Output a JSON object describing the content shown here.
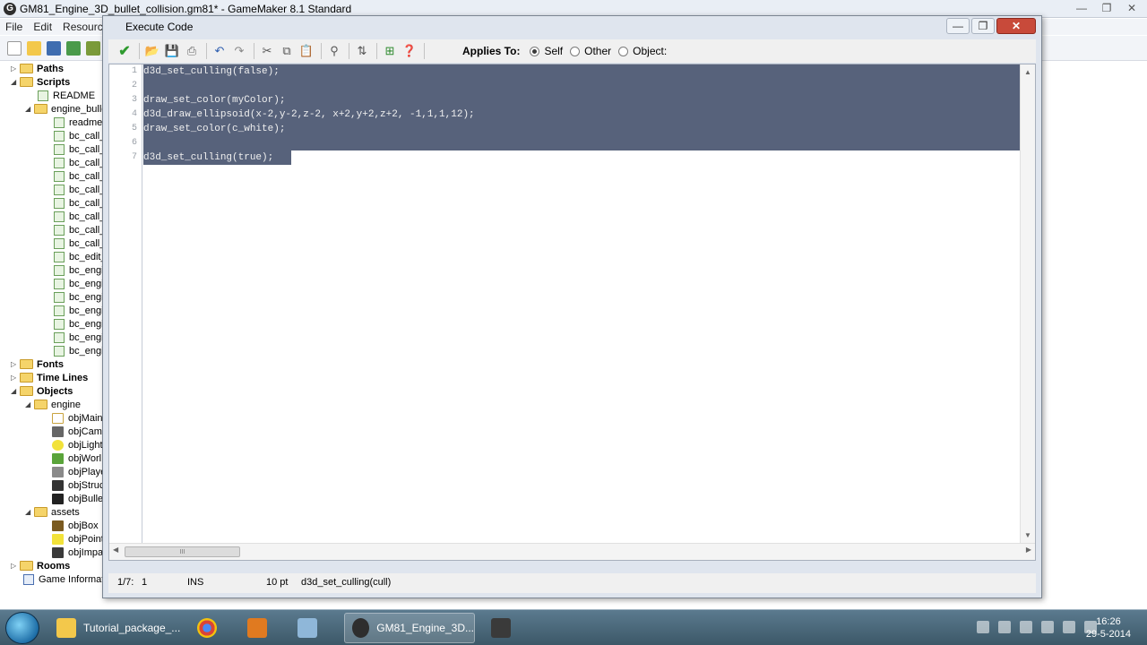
{
  "main_window": {
    "title": "GM81_Engine_3D_bullet_collision.gm81* - GameMaker 8.1 Standard",
    "menu": [
      "File",
      "Edit",
      "Resource"
    ]
  },
  "tree": {
    "paths": "Paths",
    "scripts": "Scripts",
    "readme": "README",
    "engine_folder": "engine_bulle",
    "script_items": [
      "readme",
      "bc_call_",
      "bc_call_",
      "bc_call_",
      "bc_call_",
      "bc_call_",
      "bc_call_",
      "bc_call_",
      "bc_call_",
      "bc_call_",
      "bc_edit_",
      "bc_engi",
      "bc_engi",
      "bc_engi",
      "bc_engi",
      "bc_engi",
      "bc_engi",
      "bc_engi"
    ],
    "fonts": "Fonts",
    "time_lines": "Time Lines",
    "objects": "Objects",
    "engine": "engine",
    "engine_objects": [
      "objMain",
      "objCame",
      "objLight",
      "objWorl",
      "objPlaye",
      "objStruc",
      "objBulle"
    ],
    "assets": "assets",
    "asset_objects": [
      "objBox",
      "objPoint",
      "objImpa"
    ],
    "rooms": "Rooms",
    "game_info": "Game Information"
  },
  "dialog": {
    "title": "Execute Code",
    "applies_to_label": "Applies To:",
    "options": [
      "Self",
      "Other",
      "Object:"
    ],
    "selected_option": "Self"
  },
  "editor": {
    "line_numbers": [
      "1",
      "2",
      "3",
      "4",
      "5",
      "6",
      "7"
    ],
    "lines": [
      "d3d_set_culling(false);",
      "",
      "draw_set_color(myColor);",
      "d3d_draw_ellipsoid(x-2,y-2,z-2, x+2,y+2,z+2, -1,1,1,12);",
      "draw_set_color(c_white);",
      "",
      "d3d_set_culling(true);"
    ],
    "hscroll_thumb": "III"
  },
  "status": {
    "position": "1/7:",
    "column": "1",
    "mode": "INS",
    "font_size": "10 pt",
    "hint": "d3d_set_culling(cull)"
  },
  "taskbar": {
    "items": [
      "Tutorial_package_...",
      "GM81_Engine_3D..."
    ],
    "time": "16:26",
    "date": "29-5-2014"
  },
  "colors": {
    "selection": "#57627b",
    "dialog_bg": "#dfe5ee",
    "close_button": "#c84a3a"
  }
}
